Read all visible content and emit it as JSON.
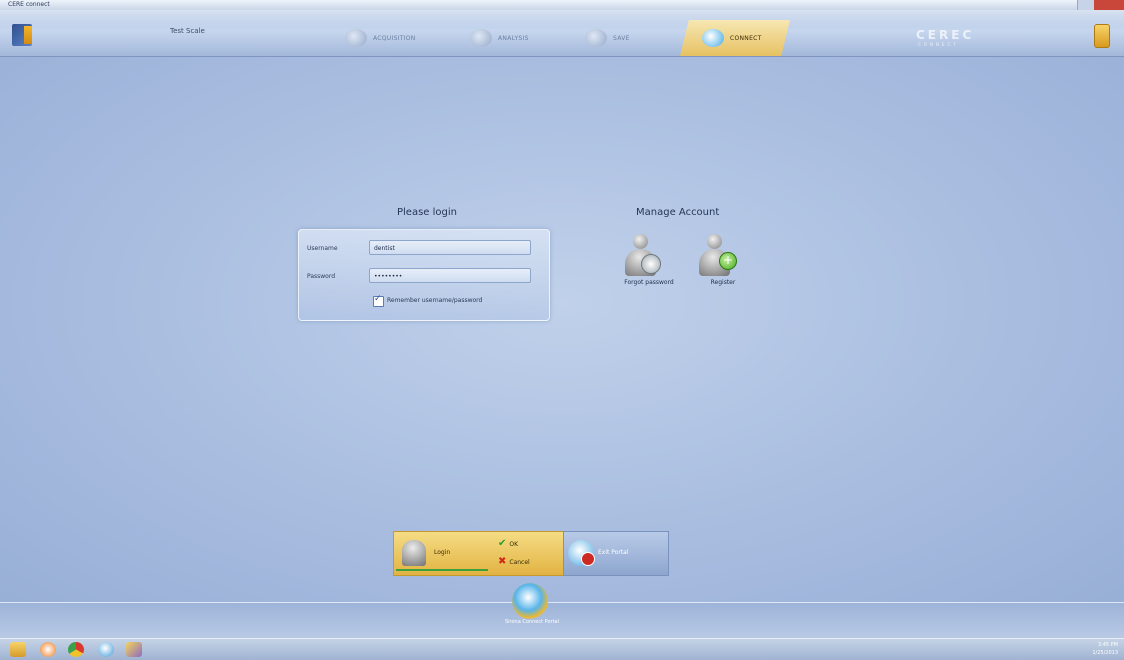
{
  "window": {
    "title": "CERE connect"
  },
  "header": {
    "user_title": "Test Scale",
    "tabs": [
      {
        "label": "ACQUISITION",
        "active": false
      },
      {
        "label": "ANALYSIS",
        "active": false
      },
      {
        "label": "SAVE",
        "active": false
      },
      {
        "label": "CONNECT",
        "active": true
      }
    ],
    "logo_text": "CEREC",
    "logo_sub": "CONNECT"
  },
  "login": {
    "heading": "Please login",
    "username_label": "Username",
    "username_value": "dentist",
    "password_label": "Password",
    "password_value": "••••••••",
    "remember_label": "Remember username/password",
    "remember_checked": true
  },
  "account": {
    "heading": "Manage Account",
    "forgot_label": "Forgot password",
    "register_label": "Register"
  },
  "actions": {
    "login_label": "Login",
    "ok_label": "OK",
    "cancel_label": "Cancel",
    "exit_label": "Exit Portal",
    "portal_label": "Sirona Connect Portal"
  },
  "taskbar": {
    "time": "3:45 PM",
    "date": "1/25/2013"
  },
  "colors": {
    "active_tab": "#e6c163",
    "background": "#a9bde0",
    "accent_green": "#42a81d",
    "accent_red": "#d12a1a"
  }
}
